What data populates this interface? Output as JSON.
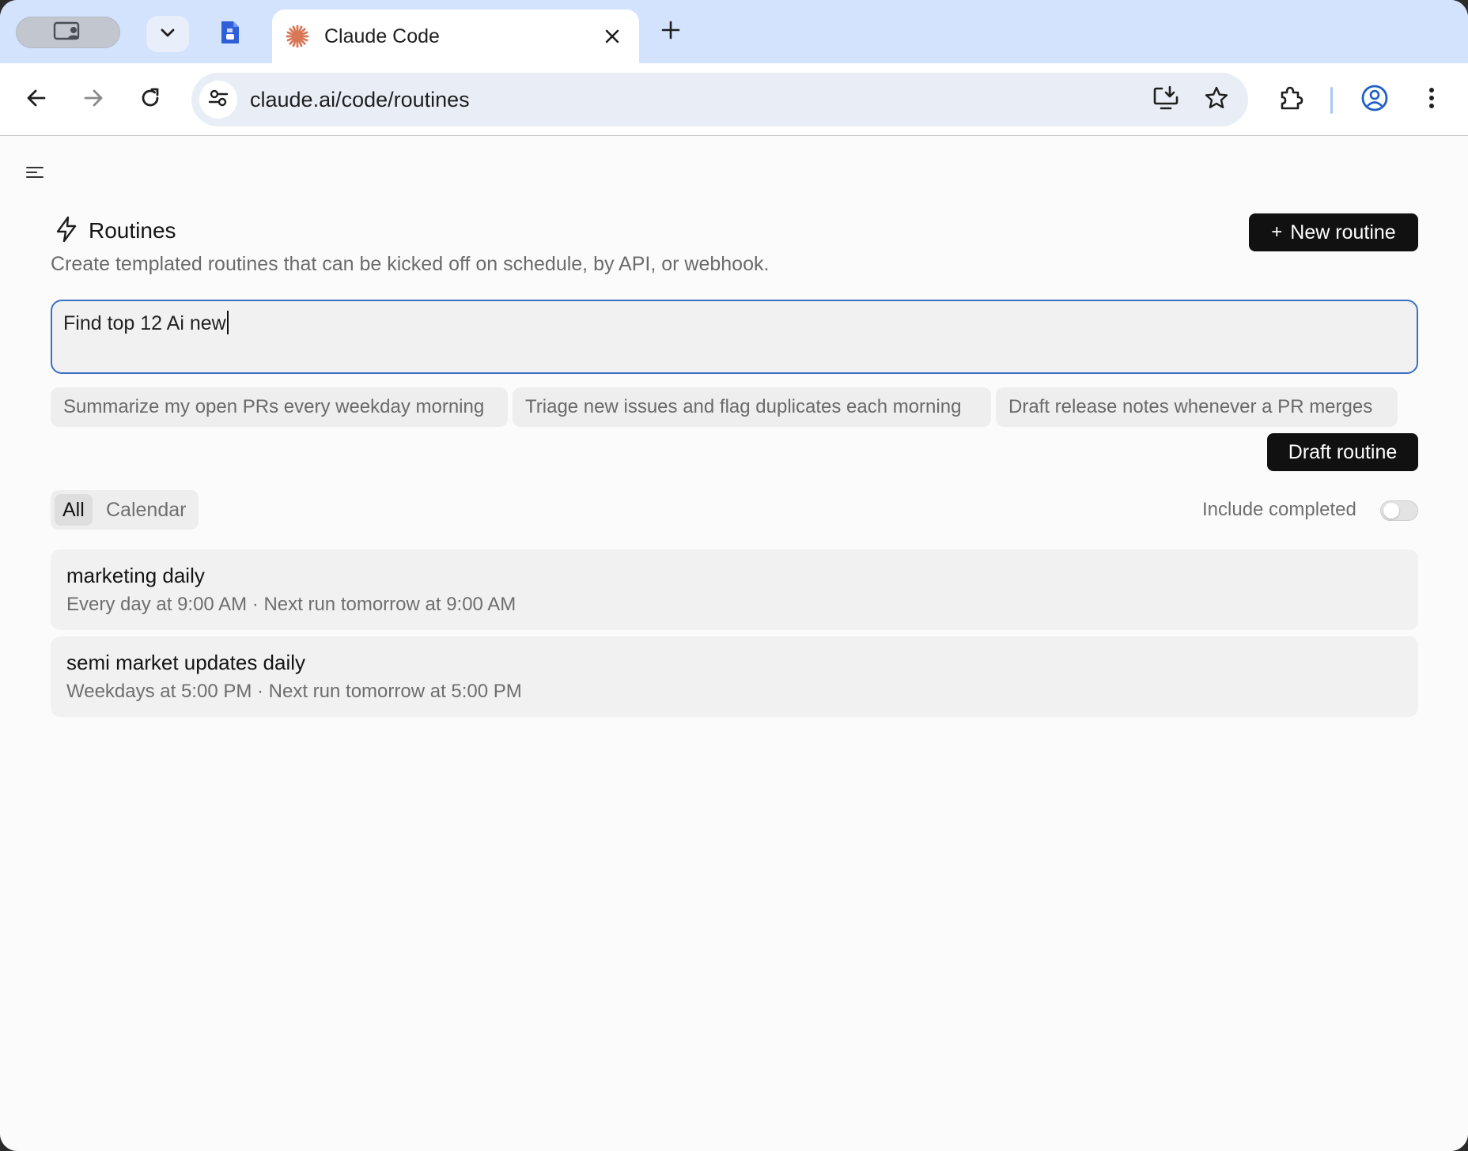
{
  "browser": {
    "tab": {
      "title": "Claude Code"
    },
    "url": "claude.ai/code/routines"
  },
  "header": {
    "title": "Routines",
    "subtitle": "Create templated routines that can be kicked off on schedule, by API, or webhook.",
    "new_button_label": "New routine",
    "new_button_plus": "+"
  },
  "prompt": {
    "value": "Find top 12 Ai new"
  },
  "suggestions": [
    "Summarize my open PRs every weekday morning",
    "Triage new issues and flag duplicates each morning",
    "Draft release notes whenever a PR merges"
  ],
  "draft_button_label": "Draft routine",
  "filters": {
    "all": "All",
    "calendar": "Calendar",
    "selected": "All"
  },
  "include_completed": {
    "label": "Include completed",
    "enabled": false
  },
  "routines": [
    {
      "name": "marketing daily",
      "schedule": "Every day at 9:00 AM · Next run tomorrow at 9:00 AM"
    },
    {
      "name": "semi market updates daily",
      "schedule": "Weekdays at 5:00 PM · Next run tomorrow at 5:00 PM"
    }
  ],
  "colors": {
    "tabstrip": "#d3e3fd",
    "accent_button": "#111111",
    "prompt_border": "#3a6fc4",
    "claude_logo": "#d97757"
  }
}
